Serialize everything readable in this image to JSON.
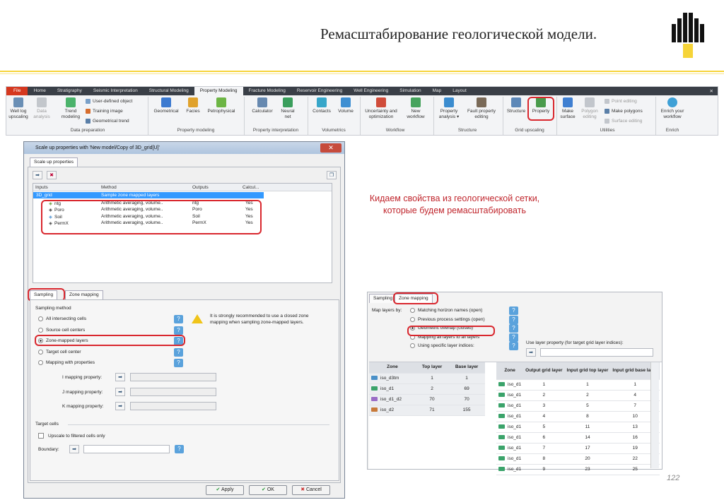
{
  "slide": {
    "title": "Ремасштабирование геологической модели.",
    "page_number": "122",
    "annotation": "Кидаем свойства из геологической сетки, которые будем ремасштабировать"
  },
  "ribbon": {
    "tabs": [
      "File",
      "Home",
      "Stratigraphy",
      "Seismic Interpretation",
      "Structural Modeling",
      "Property Modeling",
      "Fracture Modeling",
      "Reservoir Engineering",
      "Well Engineering",
      "Simulation",
      "Map",
      "Layout"
    ],
    "active_tab": "Property Modeling",
    "buttons": {
      "well_log": "Well log upscaling",
      "data_analysis": "Data analysis",
      "trend": "Trend modeling",
      "user_defined": "User-defined object",
      "training_image": "Training image",
      "geometrical_trend": "Geometrical trend",
      "geometrical": "Geometrical",
      "facies": "Facies",
      "petrophysical": "Petrophysical",
      "calculator": "Calculator",
      "neural_net": "Neural net",
      "contacts": "Contacts",
      "volume": "Volume",
      "uncertainty": "Uncertainty and optimization",
      "new_workflow": "New workflow",
      "property_analysis": "Property analysis ▾",
      "fault_property": "Fault property editing",
      "structure": "Structure",
      "property": "Property",
      "make_surface": "Make surface",
      "polygon_editing": "Polygon editing",
      "point_editing": "Point editing",
      "make_polygons": "Make polygons",
      "surface_editing": "Surface editing",
      "enrich": "Enrich your workflow"
    },
    "groups": {
      "data_prep": "Data preparation",
      "property_modeling": "Property modeling",
      "property_interp": "Property interpretation",
      "volumetrics": "Volumetrics",
      "workflow": "Workflow",
      "structure": "Structure",
      "grid_upscaling": "Grid upscaling",
      "utilities": "Utilities",
      "enrich": "Enrich"
    }
  },
  "dialog": {
    "title": "Scale up properties with 'New model/Copy of 3D_grid[U]'",
    "tab": "Scale up properties",
    "columns": [
      "Inputs",
      "Method",
      "Outputs",
      "Calcul..."
    ],
    "grid_row": {
      "input": "3D_grid",
      "method": "Sample zone mapped layers"
    },
    "rows": [
      {
        "input": "ntg",
        "method": "Arithmetic averaging, volume..",
        "output": "ntg",
        "calc": "Yes"
      },
      {
        "input": "Poro",
        "method": "Arithmetic averaging, volume..",
        "output": "Poro",
        "calc": "Yes"
      },
      {
        "input": "Soil",
        "method": "Arithmetic averaging, volume..",
        "output": "Soil",
        "calc": "Yes"
      },
      {
        "input": "PermX",
        "method": "Arithmetic averaging, volume..",
        "output": "PermX",
        "calc": "Yes"
      }
    ],
    "subtabs": {
      "sampling": "Sampling",
      "zone_mapping": "Zone mapping"
    },
    "sampling_method_label": "Sampling method",
    "options": [
      "All intersecting cells",
      "Source cell centers",
      "Zone-mapped layers",
      "Target cell center",
      "Mapping with properties"
    ],
    "selected_option": "Zone-mapped layers",
    "warning": "It is strongly recommended to use a closed zone mapping when sampling zone-mapped layers.",
    "i_mapping": "I mapping property:",
    "j_mapping": "J mapping property:",
    "k_mapping": "K mapping property:",
    "target_cells": "Target cells",
    "upscale_filtered": "Upscale to filtered cells only",
    "boundary": "Boundary:",
    "apply": "Apply",
    "ok": "OK",
    "cancel": "Cancel"
  },
  "zone_panel": {
    "tabs": {
      "sampling": "Sampling",
      "zone_mapping": "Zone mapping"
    },
    "map_layers_by": "Map layers by:",
    "options": [
      "Matching horizon names (open)",
      "Previous process settings (open)",
      "Geometric overlap (closed)",
      "Mapping all layers to all layers",
      "Using specific layer indices:"
    ],
    "selected": "Geometric overlap (closed)",
    "use_layer_property": "Use layer property (for target grid layer indices):",
    "left_headers": [
      "Zone",
      "Top layer",
      "Base layer"
    ],
    "left_rows": [
      [
        "iso_d3tm",
        "1",
        "1"
      ],
      [
        "iso_d1",
        "2",
        "69"
      ],
      [
        "iso_d1_d2",
        "70",
        "70"
      ],
      [
        "iso_d2",
        "71",
        "155"
      ]
    ],
    "right_headers": [
      "Zone",
      "Output grid layer",
      "Input grid top layer",
      "Input grid base layer"
    ],
    "right_rows": [
      [
        "iso_d1",
        "1",
        "1",
        "1"
      ],
      [
        "iso_d1",
        "2",
        "2",
        "4"
      ],
      [
        "iso_d1",
        "3",
        "5",
        "7"
      ],
      [
        "iso_d1",
        "4",
        "8",
        "10"
      ],
      [
        "iso_d1",
        "5",
        "11",
        "13"
      ],
      [
        "iso_d1",
        "6",
        "14",
        "16"
      ],
      [
        "iso_d1",
        "7",
        "17",
        "19"
      ],
      [
        "iso_d1",
        "8",
        "20",
        "22"
      ],
      [
        "iso_d1",
        "9",
        "23",
        "25"
      ]
    ]
  },
  "colors": {
    "accent_red": "#d9272e",
    "highlight": "#3399ff",
    "brand_yellow": "#f6d438"
  }
}
